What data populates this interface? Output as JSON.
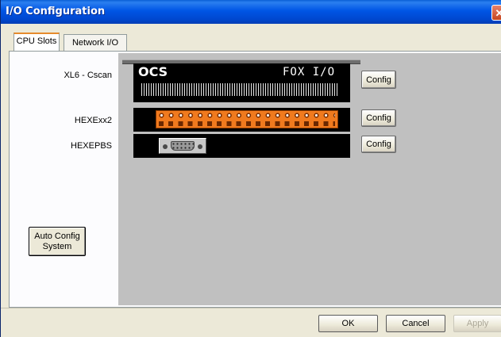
{
  "window": {
    "title": "I/O Configuration",
    "close_glyph": "✕"
  },
  "tabs": [
    {
      "label": "CPU Slots",
      "active": true
    },
    {
      "label": "Network I/O",
      "active": false
    }
  ],
  "slots": [
    {
      "label": "XL6 - Cscan",
      "config_label": "Config"
    },
    {
      "label": "HEXExx2",
      "config_label": "Config"
    },
    {
      "label": "HEXEPBS",
      "config_label": "Config"
    }
  ],
  "device": {
    "brand": "OCS",
    "model": "FOX I/O",
    "terminal_color": "#f07a1e"
  },
  "auto_config": {
    "line1": "Auto Config",
    "line2": "System"
  },
  "footer": {
    "ok": "OK",
    "cancel": "Cancel",
    "apply": "Apply"
  },
  "colors": {
    "titlebar": "#0055e5",
    "workarea": "#c0c0c0",
    "dialog": "#ece9d8"
  }
}
